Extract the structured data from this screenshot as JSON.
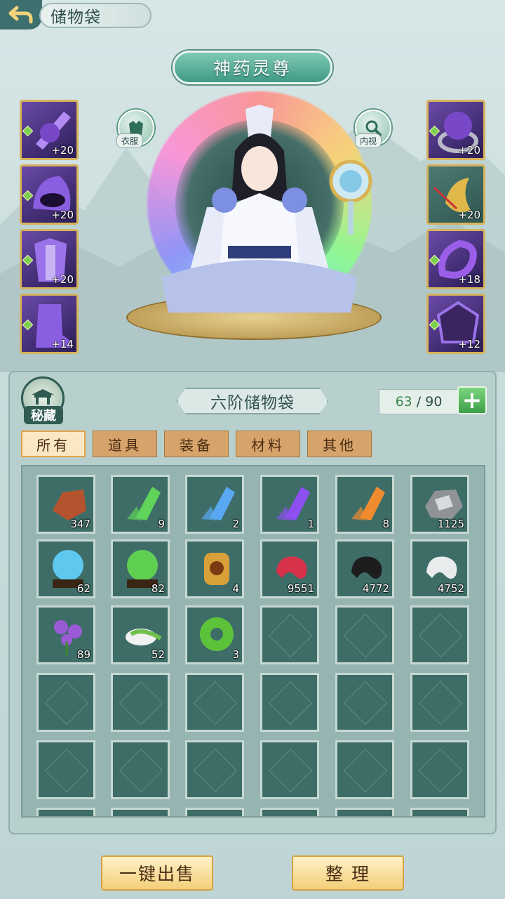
{
  "header": {
    "title": "储物袋"
  },
  "character": {
    "name": "神药灵尊"
  },
  "buttons": {
    "wardrobe_label": "衣服",
    "inspect_label": "内视"
  },
  "equip_left": [
    {
      "item": "purple-skull-staff",
      "level": "+20"
    },
    {
      "item": "purple-helmet",
      "level": "+20"
    },
    {
      "item": "purple-armor",
      "level": "+20"
    },
    {
      "item": "purple-boots",
      "level": "+14"
    }
  ],
  "equip_right": [
    {
      "item": "purple-skull-ring",
      "level": "+20"
    },
    {
      "item": "gold-amulet",
      "level": "+20"
    },
    {
      "item": "purple-bracelet",
      "level": "+18"
    },
    {
      "item": "purple-talisman",
      "level": "+12"
    }
  ],
  "panel": {
    "emblem_label": "秘藏",
    "bag_title": "六阶储物袋",
    "capacity_used": "63",
    "capacity_sep": " / ",
    "capacity_total": "90",
    "add_label": "+"
  },
  "tabs": [
    "所有",
    "道具",
    "装备",
    "材料",
    "其他"
  ],
  "items": [
    {
      "icon": "red-ore",
      "count": "347",
      "color": "#b5532e"
    },
    {
      "icon": "green-crystal",
      "count": "9",
      "color": "#5fd35a"
    },
    {
      "icon": "blue-crystal",
      "count": "2",
      "color": "#58a8f2"
    },
    {
      "icon": "purple-crystal",
      "count": "1",
      "color": "#8d4ff0"
    },
    {
      "icon": "orange-crystal",
      "count": "8",
      "color": "#f08c2f"
    },
    {
      "icon": "silver-ore",
      "count": "1125",
      "color": "#8f9396"
    },
    {
      "icon": "blue-orb",
      "count": "62",
      "color": "#5fc8ee"
    },
    {
      "icon": "green-orb",
      "count": "82",
      "color": "#5fcf52"
    },
    {
      "icon": "gold-token",
      "count": "4",
      "color": "#d9a03a"
    },
    {
      "icon": "red-jade",
      "count": "9551",
      "color": "#d8324a"
    },
    {
      "icon": "black-jade",
      "count": "4772",
      "color": "#1d1d1d"
    },
    {
      "icon": "white-jade",
      "count": "4752",
      "color": "#e8ecec"
    },
    {
      "icon": "purple-flower",
      "count": "89",
      "color": "#9b5ad6"
    },
    {
      "icon": "herb-bowl",
      "count": "52",
      "color": "#6fc04c"
    },
    {
      "icon": "green-jade-ring",
      "count": "3",
      "color": "#5cc23a"
    }
  ],
  "bottom": {
    "sell_label": "一键出售",
    "sort_label": "整 理"
  }
}
